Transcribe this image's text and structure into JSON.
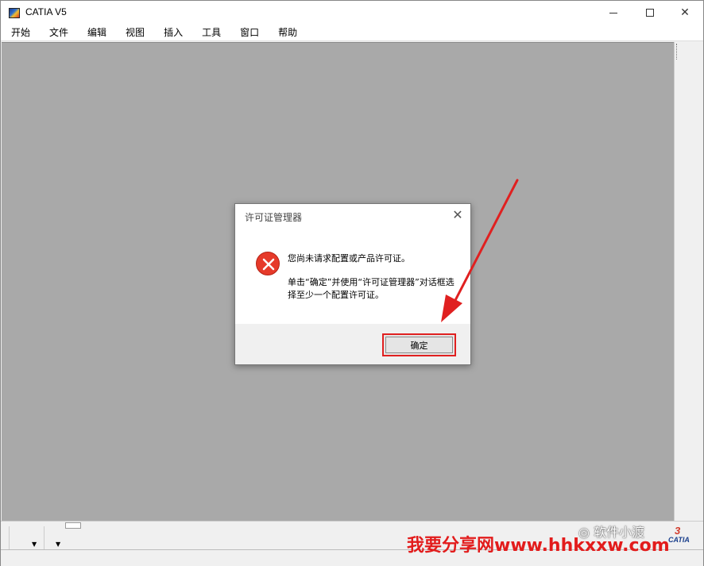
{
  "window": {
    "title": "CATIA V5",
    "minimize": "—",
    "maximize": "☐",
    "close": "✕"
  },
  "menu": {
    "items": [
      {
        "label": "开始"
      },
      {
        "label": "文件"
      },
      {
        "label": "编辑"
      },
      {
        "label": "视图"
      },
      {
        "label": "插入"
      },
      {
        "label": "工具"
      },
      {
        "label": "窗口"
      },
      {
        "label": "帮助"
      }
    ]
  },
  "dialog": {
    "title": "许可证管理器",
    "close": "✕",
    "message_line1": "您尚未请求配置或产品许可证。",
    "message_line2": "单击“确定”并使用“许可证管理器”对话框选择至少一个配置许可证。",
    "ok_label": "确定"
  },
  "watermark": {
    "wechat": "软件小渡",
    "site": "我要分享网www.hhkxxw.com"
  },
  "logo": {
    "mark": "3",
    "text": "CATIA"
  },
  "colors": {
    "workspace": "#a9a9a9",
    "error": "#e63a2a",
    "annotation": "#e02020"
  }
}
